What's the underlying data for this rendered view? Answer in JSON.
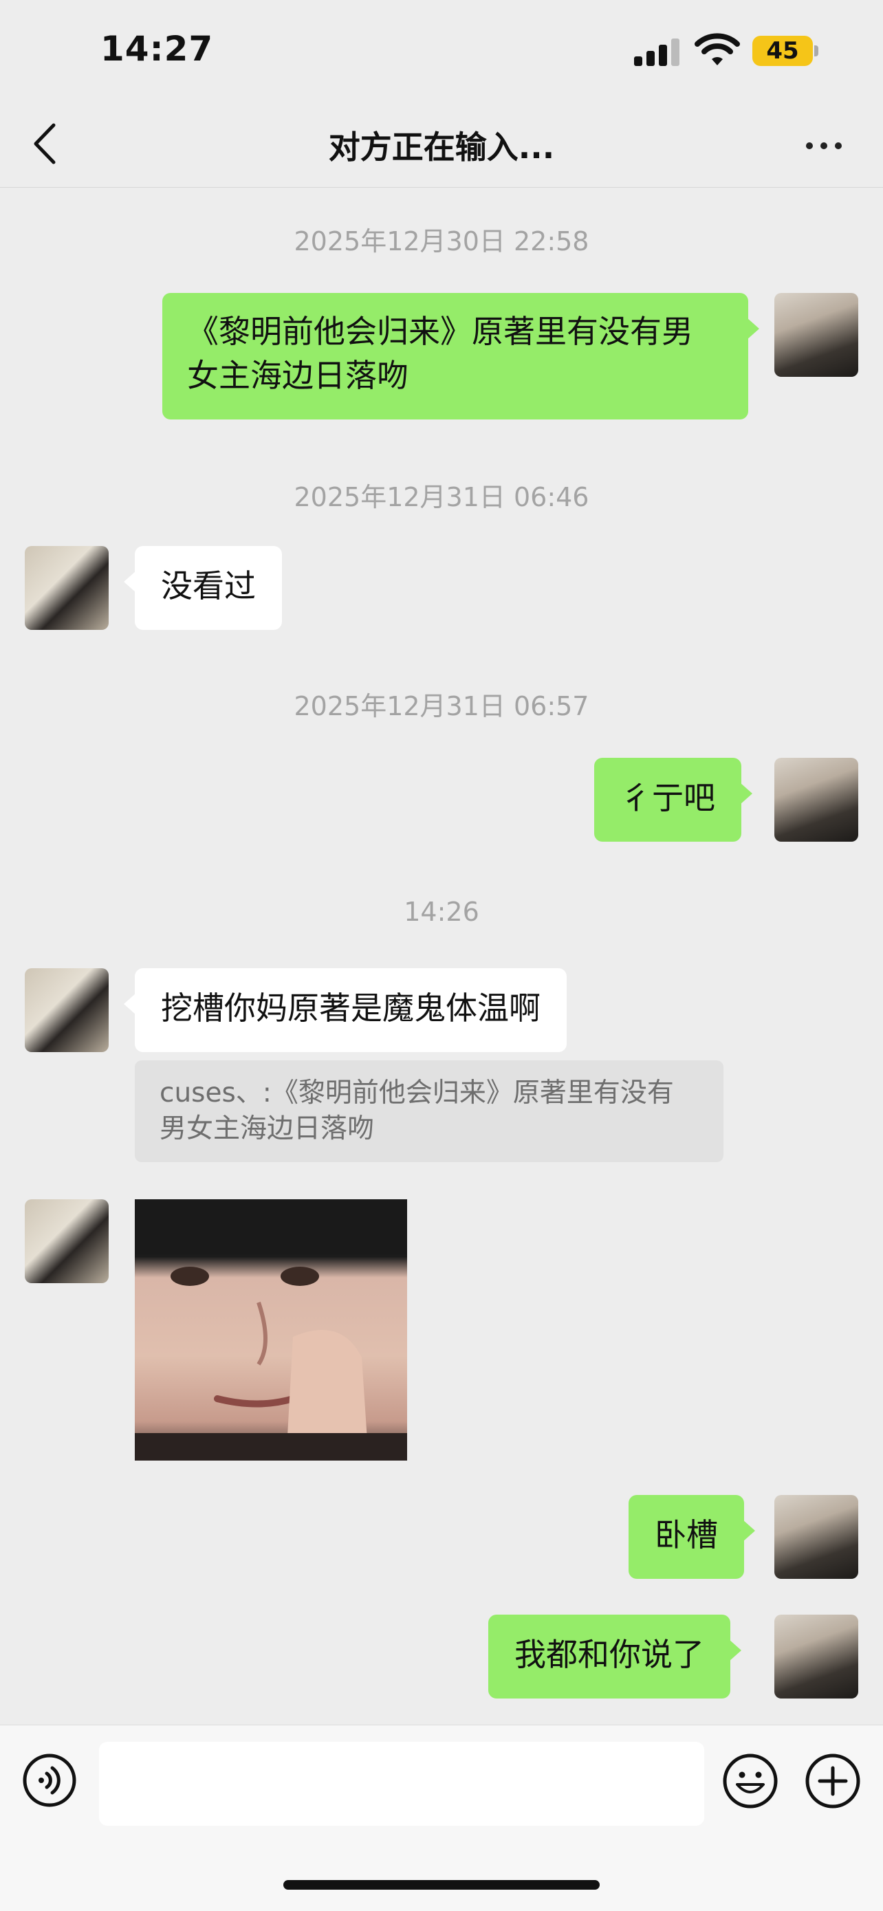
{
  "status_bar": {
    "time": "14:27",
    "battery": "45"
  },
  "nav": {
    "title": "对方正在输入..."
  },
  "messages": [
    {
      "timestamp": "2025年12月30日 22:58"
    },
    {
      "out_text": "《黎明前他会归来》原著里有没有男\n女主海边日落吻"
    },
    {
      "timestamp": "2025年12月31日 06:46"
    },
    {
      "in_text": "没看过"
    },
    {
      "timestamp": "2025年12月31日 06:57"
    },
    {
      "out_text": "彳亍吧"
    },
    {
      "timestamp": "14:26"
    },
    {
      "in_text": "挖槽你妈原著是魔鬼体温啊",
      "quote": "cuses、:《黎明前他会归来》原著里有没有\n男女主海边日落吻"
    },
    {
      "in_sticker": "sticker"
    },
    {
      "out_text": "卧槽"
    },
    {
      "out_text": "我都和你说了"
    }
  ],
  "colors": {
    "outgoing_bubble": "#95ec69",
    "incoming_bubble": "#ffffff",
    "background": "#ededed"
  },
  "icons": [
    "back-chevron-icon",
    "more-dots-icon",
    "voice-icon",
    "emoji-icon",
    "plus-icon"
  ]
}
